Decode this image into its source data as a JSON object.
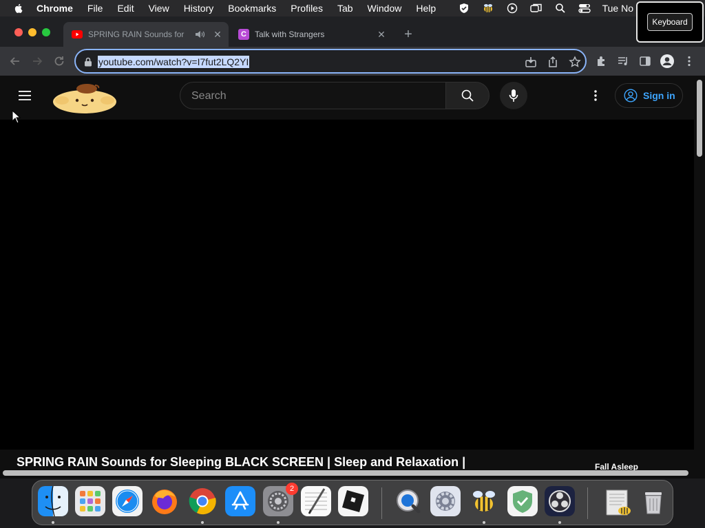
{
  "menubar": {
    "app_name": "Chrome",
    "items": [
      "File",
      "Edit",
      "View",
      "History",
      "Bookmarks",
      "Profiles",
      "Tab",
      "Window",
      "Help"
    ],
    "clock": "Tue No"
  },
  "keyboard_overlay": {
    "label": "Keyboard"
  },
  "tabs": [
    {
      "title": "SPRING RAIN Sounds for",
      "favicon": "youtube-icon",
      "active": true,
      "audio": true
    },
    {
      "title": "Talk with Strangers",
      "favicon": "chatroom-c-icon",
      "active": false,
      "audio": false
    }
  ],
  "omnibox": {
    "url": "youtube.com/watch?v=I7fut2LQ2YI"
  },
  "youtube": {
    "search_placeholder": "Search",
    "sign_in_label": "Sign in",
    "video_title": "SPRING RAIN Sounds for Sleeping BLACK SCREEN | Sleep and Relaxation |",
    "side_text": "Fall Asleep"
  },
  "dock": {
    "apps": [
      "Finder",
      "Launchpad",
      "Safari",
      "Firefox",
      "Google Chrome",
      "App Store",
      "System Preferences",
      "TextEdit",
      "Roblox",
      "QuickTime Player",
      "Settings",
      "Cyberduck",
      "AdGuard",
      "OBS",
      "Downloads",
      "Trash"
    ],
    "system_prefs_badge": "2"
  },
  "colors": {
    "accent": "#8ab4f8",
    "youtube_red": "#ff0000",
    "signin_blue": "#3ea6ff",
    "page_bg": "#0f0f0f"
  }
}
